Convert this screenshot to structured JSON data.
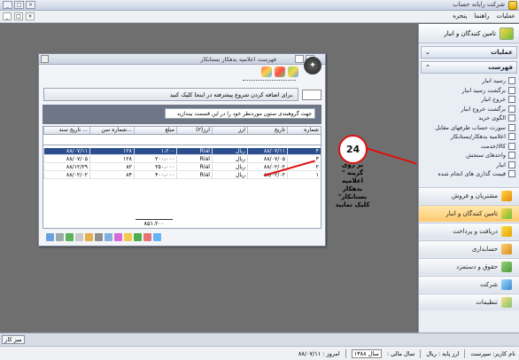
{
  "app": {
    "title": "شرکت رایانه حساب"
  },
  "window_buttons": [
    "_",
    "□",
    "×"
  ],
  "menubar": {
    "items": [
      "عملیات",
      "راهنما",
      "پنجره"
    ]
  },
  "sidebar": {
    "header": "تامین کنندگان و انبار",
    "section_ops": "عملیات",
    "section_list": "فهرست",
    "items": [
      "رسید انبار",
      "برگشت رسید انبار",
      "خروج انبار",
      "برگشت خروج انبار",
      "الگوی خرید",
      "سورت حساب طرفهای مقابل",
      "اعلامیه بدهکار/بستانکار",
      "کالا/خدمت",
      "واحدهای سنجش",
      "انبار",
      "قیمت گذاری های انجام شده"
    ],
    "modules": [
      "مشتریان و فروش",
      "تامین کنندگان و انبار",
      "دریافت و پرداخت",
      "حسابداری",
      "حقوق و دستمزد",
      "شرکت",
      "تنظیمات"
    ],
    "active_module": "تامین کنندگان و انبار"
  },
  "child_window": {
    "title": "فهرست اعلامیه بدهکار بستانکار",
    "new_row_text": "برای اضافه کردن شروع پیشرفته در اینجا کلیک کنید.",
    "group_hint": "جهت گروهبندی ستون موردنظر خود را در این قسمت بیندازید",
    "columns": [
      "شماره",
      "تاریخ",
      "ارز",
      "ارز(۲)",
      "مبلغ",
      "شماره سن...",
      "تاریخ سند ..."
    ],
    "rows": [
      [
        "۴",
        "۸۸/۰۷/۱۱",
        "ریال",
        "Rial",
        "۱،۲۰۰",
        "۱۲۸",
        "۸۸/۰۷/۱۱"
      ],
      [
        "۳",
        "۸۸/۰۷/۰۵",
        "ریال",
        "Rial",
        "۲۰۰،۰۰۰",
        "۱۲۸",
        "۸۸/۰۷/۰۵"
      ],
      [
        "۲",
        "۸۸/۰۲/۰۲",
        "ریال",
        "Rial",
        "۲۵۰،۰۰۰",
        "۸۲",
        "۸۸/۱۲/۲۹"
      ],
      [
        "۱",
        "۸۸/۰۲/۰۲",
        "ریال",
        "Rial",
        "۴۰۰،۰۰۰",
        "۸۴",
        "۸۸/۰۲/۰۲"
      ]
    ],
    "selected_row": 0,
    "total": "۸۵۱،۲۰۰"
  },
  "annotation": {
    "step": "24",
    "text": "بر روی گزینه \" اعلامیه بدهکار بستانکار\" کلیک نمایید"
  },
  "statusbar": {
    "desktop_button": "میز کار",
    "company": "نام کاربر: سپرست",
    "currency_label": "ارز پایه : ریال",
    "fiscal_year_label": "سال مالی :",
    "fiscal_year_value": "سال ۱۳۸۸",
    "today": "امروز : ۸۸/۰۷/۱۱"
  },
  "colors": {
    "workspace": "#6f6f6f",
    "selected_row": "#2b4f8e",
    "annotation_red": "#e01010",
    "active_module": "#ffc86a"
  }
}
